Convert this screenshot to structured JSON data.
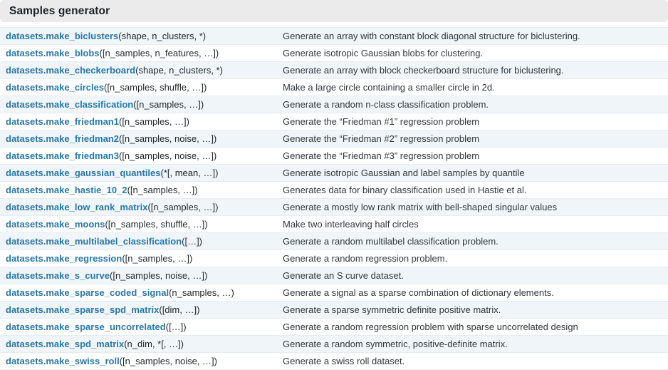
{
  "header": {
    "title": "Samples generator"
  },
  "colors": {
    "header_background": "#ebebeb",
    "link": "#2878a8",
    "row_shaded": "#eff5f8",
    "row_plain": "#ffffff",
    "row_border": "#e6ecef",
    "text": "#24292e"
  },
  "table": {
    "rows": [
      {
        "name": "datasets.make_biclusters",
        "args": "(shape, n_clusters, *)",
        "description": "Generate an array with constant block diagonal structure for biclustering."
      },
      {
        "name": "datasets.make_blobs",
        "args": "([n_samples, n_features, …])",
        "description": "Generate isotropic Gaussian blobs for clustering."
      },
      {
        "name": "datasets.make_checkerboard",
        "args": "(shape, n_clusters, *)",
        "description": "Generate an array with block checkerboard structure for biclustering."
      },
      {
        "name": "datasets.make_circles",
        "args": "([n_samples, shuffle, …])",
        "description": "Make a large circle containing a smaller circle in 2d."
      },
      {
        "name": "datasets.make_classification",
        "args": "([n_samples, …])",
        "description": "Generate a random n-class classification problem."
      },
      {
        "name": "datasets.make_friedman1",
        "args": "([n_samples, …])",
        "description": "Generate the  “Friedman #1”  regression problem"
      },
      {
        "name": "datasets.make_friedman2",
        "args": "([n_samples, noise, …])",
        "description": "Generate the  “Friedman #2”  regression problem"
      },
      {
        "name": "datasets.make_friedman3",
        "args": "([n_samples, noise, …])",
        "description": "Generate the  “Friedman #3”  regression problem"
      },
      {
        "name": "datasets.make_gaussian_quantiles",
        "args": "(*[, mean, …])",
        "description": "Generate isotropic Gaussian and label samples by quantile"
      },
      {
        "name": "datasets.make_hastie_10_2",
        "args": "([n_samples, …])",
        "description": "Generates data for binary classification used in Hastie et al."
      },
      {
        "name": "datasets.make_low_rank_matrix",
        "args": "([n_samples, …])",
        "description": "Generate a mostly low rank matrix with bell-shaped singular values"
      },
      {
        "name": "datasets.make_moons",
        "args": "([n_samples, shuffle, …])",
        "description": "Make two interleaving half circles"
      },
      {
        "name": "datasets.make_multilabel_classification",
        "args": "([…])",
        "description": "Generate a random multilabel classification problem."
      },
      {
        "name": "datasets.make_regression",
        "args": "([n_samples, …])",
        "description": "Generate a random regression problem."
      },
      {
        "name": "datasets.make_s_curve",
        "args": "([n_samples, noise, …])",
        "description": "Generate an S curve dataset."
      },
      {
        "name": "datasets.make_sparse_coded_signal",
        "args": "(n_samples, …)",
        "description": "Generate a signal as a sparse combination of dictionary elements."
      },
      {
        "name": "datasets.make_sparse_spd_matrix",
        "args": "([dim, …])",
        "description": "Generate a sparse symmetric definite positive matrix."
      },
      {
        "name": "datasets.make_sparse_uncorrelated",
        "args": "([…])",
        "description": "Generate a random regression problem with sparse uncorrelated design"
      },
      {
        "name": "datasets.make_spd_matrix",
        "args": "(n_dim, *[, …])",
        "description": "Generate a random symmetric, positive-definite matrix."
      },
      {
        "name": "datasets.make_swiss_roll",
        "args": "([n_samples, noise, …])",
        "description": "Generate a swiss roll dataset."
      }
    ]
  }
}
